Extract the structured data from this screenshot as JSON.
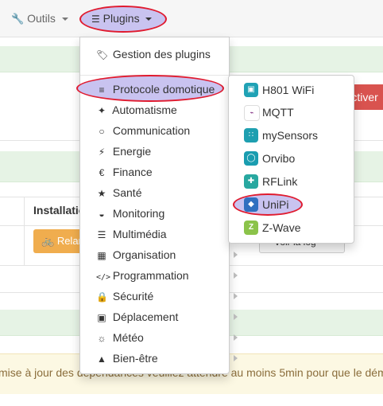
{
  "navbar": {
    "outils_label": "Outils",
    "plugins_label": "Plugins"
  },
  "dropdown": {
    "gestion_label": "Gestion des plugins",
    "items": [
      {
        "label": "Protocole domotique",
        "icon": "rss-icon"
      },
      {
        "label": "Automatisme",
        "icon": "magic-wand-icon"
      },
      {
        "label": "Communication",
        "icon": "comment-icon"
      },
      {
        "label": "Energie",
        "icon": "bolt-icon"
      },
      {
        "label": "Finance",
        "icon": "euro-icon"
      },
      {
        "label": "Santé",
        "icon": "running-icon"
      },
      {
        "label": "Monitoring",
        "icon": "dashboard-icon"
      },
      {
        "label": "Multimédia",
        "icon": "sliders-icon"
      },
      {
        "label": "Organisation",
        "icon": "calendar-icon"
      },
      {
        "label": "Programmation",
        "icon": "code-icon"
      },
      {
        "label": "Sécurité",
        "icon": "lock-icon"
      },
      {
        "label": "Déplacement",
        "icon": "car-icon"
      },
      {
        "label": "Météo",
        "icon": "sun-icon"
      },
      {
        "label": "Bien-être",
        "icon": "user-icon"
      }
    ]
  },
  "submenu": {
    "items": [
      {
        "label": "H801 WiFi",
        "color": "#20a2b5",
        "icon": "h801-logo"
      },
      {
        "label": "MQTT",
        "color": "#ffffff",
        "icon": "mqtt-logo"
      },
      {
        "label": "mySensors",
        "color": "#1e9fb0",
        "icon": "mysensors-logo"
      },
      {
        "label": "Orvibo",
        "color": "#1a9db0",
        "icon": "orvibo-logo"
      },
      {
        "label": "RFLink",
        "color": "#28a8a0",
        "icon": "rflink-logo"
      },
      {
        "label": "UniPi",
        "color": "#3070c0",
        "icon": "unipi-logo"
      },
      {
        "label": "Z-Wave",
        "color": "#8bc34a",
        "icon": "zwave-logo"
      }
    ]
  },
  "background": {
    "activer_label": "Activer",
    "installation_label": "Installatio",
    "relancer_label": "Relan",
    "log_label": "Voir la log",
    "warning_text": "mise à jour des dépendances veuillez attendre au moins 5min pour que le démo"
  },
  "colors": {
    "highlight": "#c9c3f0",
    "circle": "#e01b2f",
    "accent_red": "#d9534f",
    "accent_orange": "#f0ad4e"
  }
}
